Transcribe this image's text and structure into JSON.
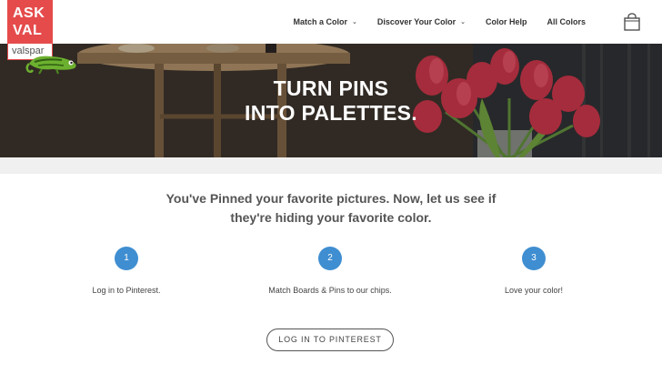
{
  "logo": {
    "line1": "ASK",
    "line2": "VAL",
    "brand": "valspar"
  },
  "nav": {
    "items": [
      {
        "label": "Match a Color",
        "dropdown": true
      },
      {
        "label": "Discover Your Color",
        "dropdown": true
      },
      {
        "label": "Color Help",
        "dropdown": false
      },
      {
        "label": "All Colors",
        "dropdown": false
      }
    ],
    "cart_icon": "shopping-bag-icon"
  },
  "hero": {
    "title_line1": "TURN PINS",
    "title_line2": "INTO PALETTES."
  },
  "intro": {
    "line1": "You've Pinned your favorite pictures. Now, let us see if",
    "line2": "they're hiding your favorite color."
  },
  "steps": [
    {
      "number": "1",
      "text": "Log in to Pinterest."
    },
    {
      "number": "2",
      "text": "Match Boards & Pins to our chips."
    },
    {
      "number": "3",
      "text": "Love your color!"
    }
  ],
  "cta": {
    "label": "LOG IN TO PINTEREST"
  },
  "colors": {
    "brand_red": "#e54b4b",
    "step_blue": "#3f8ed1"
  }
}
